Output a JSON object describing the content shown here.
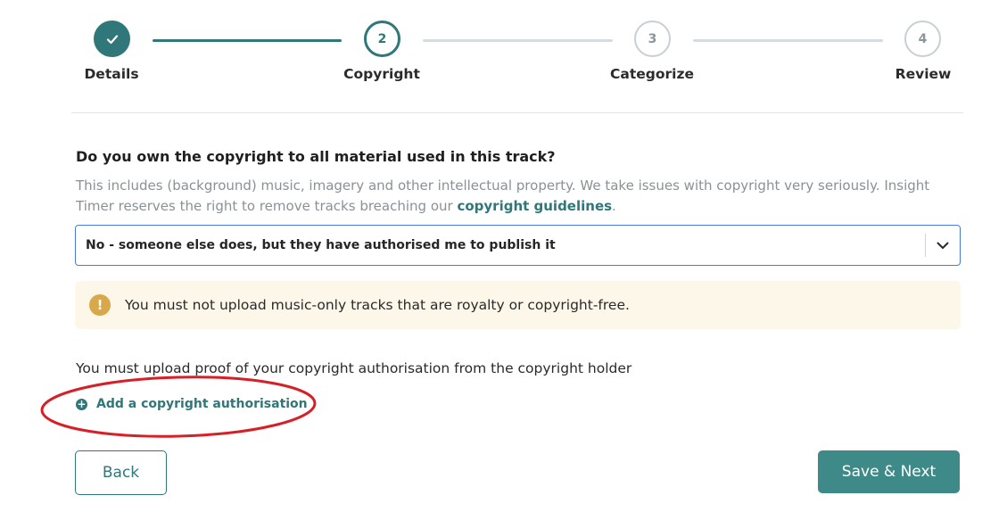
{
  "stepper": {
    "steps": [
      {
        "number": "",
        "label": "Details",
        "state": "complete"
      },
      {
        "number": "2",
        "label": "Copyright",
        "state": "active"
      },
      {
        "number": "3",
        "label": "Categorize",
        "state": "pending"
      },
      {
        "number": "4",
        "label": "Review",
        "state": "pending"
      }
    ]
  },
  "question": {
    "title": "Do you own the copyright to all material used in this track?",
    "helper_text": "This includes (background) music, imagery and other intellectual property. We take issues with copyright very seriously. Insight Timer reserves the right to remove tracks breaching our",
    "link_text": "copyright guidelines",
    "helper_suffix": "."
  },
  "ownership_select": {
    "value": "No - someone else does, but they have authorised me to publish it",
    "icon": "chevron-down-icon"
  },
  "warning": {
    "icon": "exclamation-icon",
    "text": "You must not upload music-only tracks that are royalty or copyright-free."
  },
  "upload": {
    "instruction": "You must upload proof of your copyright authorisation from the copyright holder",
    "add_label": "Add a copyright authorisation",
    "add_icon": "plus-circle-icon"
  },
  "footer": {
    "back_label": "Back",
    "next_label": "Save & Next"
  },
  "colors": {
    "accent": "#2f7779",
    "button": "#3e8a89",
    "warning_bg": "#fdf7ea",
    "warning_icon": "#d9a84a",
    "annotation": "#d61f26"
  }
}
